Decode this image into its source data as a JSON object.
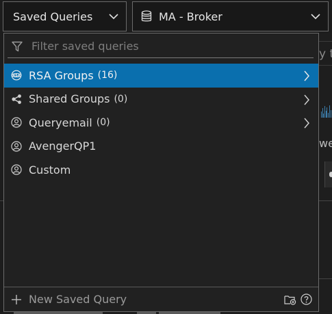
{
  "selectors": {
    "saved_queries": {
      "label": "Saved Queries",
      "icon": "chevron-down-icon"
    },
    "service": {
      "label": "MA - Broker",
      "icon": "database-icon"
    }
  },
  "filter": {
    "placeholder": "Filter saved queries",
    "value": "",
    "icon": "filter-icon"
  },
  "items": [
    {
      "label": "RSA Groups",
      "count": "(16)",
      "icon": "rsa-logo-icon",
      "has_children": true,
      "active": true
    },
    {
      "label": "Shared Groups",
      "count": "(0)",
      "icon": "share-icon",
      "has_children": true,
      "active": false
    },
    {
      "label": "Queryemail",
      "count": "(0)",
      "icon": "user-icon",
      "has_children": true,
      "active": false
    },
    {
      "label": "AvengerQP1",
      "count": "",
      "icon": "user-icon",
      "has_children": false,
      "active": false
    },
    {
      "label": "Custom",
      "count": "",
      "icon": "user-icon",
      "has_children": false,
      "active": false
    }
  ],
  "footer": {
    "new_label": "New Saved Query",
    "icons": [
      "plus-icon",
      "folder-add-icon",
      "help-icon"
    ]
  },
  "background": {
    "search_fragment": "y t",
    "word_fragment": "we"
  },
  "colors": {
    "active_row": "#0a6fae",
    "border": "#6b6b6b",
    "panel": "#212121"
  }
}
